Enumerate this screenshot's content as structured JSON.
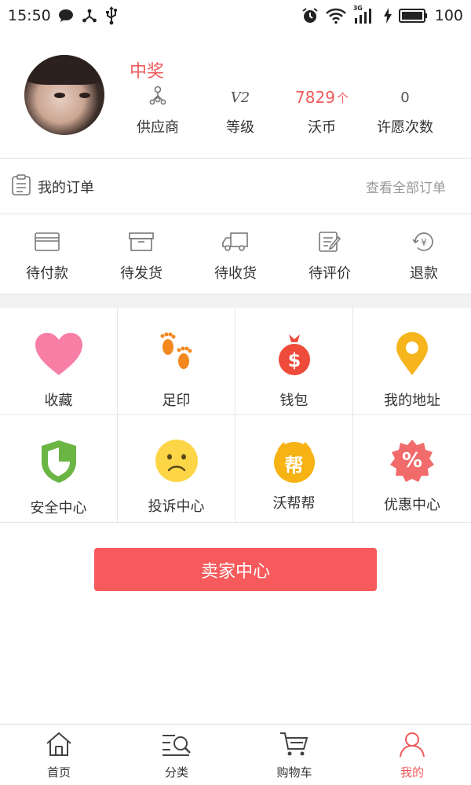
{
  "status_bar": {
    "time": "15:50",
    "battery": "100",
    "network": "3G"
  },
  "profile": {
    "username": "中奖",
    "stats": [
      {
        "icon": "supplier-icon",
        "label": "供应商"
      },
      {
        "icon": "level-icon",
        "value": "V2",
        "label": "等级"
      },
      {
        "value": "7829",
        "unit": "个",
        "label": "沃币"
      },
      {
        "value": "0",
        "label": "许愿次数"
      }
    ]
  },
  "orders": {
    "title": "我的订单",
    "view_all": "查看全部订单"
  },
  "order_status": [
    {
      "icon": "card-icon",
      "label": "待付款"
    },
    {
      "icon": "box-icon",
      "label": "待发货"
    },
    {
      "icon": "truck-icon",
      "label": "待收货"
    },
    {
      "icon": "review-icon",
      "label": "待评价"
    },
    {
      "icon": "refund-icon",
      "label": "退款"
    }
  ],
  "grid": [
    {
      "icon": "heart-icon",
      "label": "收藏"
    },
    {
      "icon": "footprint-icon",
      "label": "足印"
    },
    {
      "icon": "money-bag-icon",
      "label": "钱包"
    },
    {
      "icon": "location-pin-icon",
      "label": "我的地址"
    },
    {
      "icon": "shield-icon",
      "label": "安全中心"
    },
    {
      "icon": "sad-face-icon",
      "label": "投诉中心"
    },
    {
      "icon": "help-badge-icon",
      "label": "沃帮帮",
      "badge_text": "帮"
    },
    {
      "icon": "discount-icon",
      "label": "优惠中心",
      "badge_text": "%"
    }
  ],
  "seller_button": "卖家中心",
  "bottom_nav": [
    {
      "icon": "home-icon",
      "label": "首页",
      "active": false
    },
    {
      "icon": "category-icon",
      "label": "分类",
      "active": false
    },
    {
      "icon": "cart-icon",
      "label": "购物车",
      "active": false
    },
    {
      "icon": "user-icon",
      "label": "我的",
      "active": true
    }
  ],
  "colors": {
    "accent": "#f05a5a",
    "button": "#f65a5c",
    "heart": "#f77fa6",
    "footprint": "#f3891e",
    "money_bag": "#ee4b3a",
    "pin": "#f6b51d",
    "shield": "#6bb544",
    "sad_face": "#fdd647",
    "help_badge": "#f7b213",
    "discount": "#f16b6b"
  }
}
